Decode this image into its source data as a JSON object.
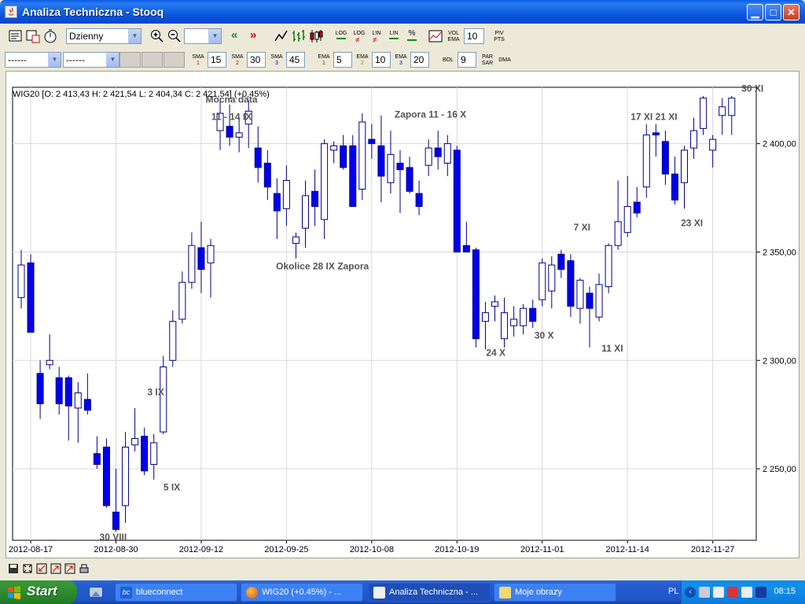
{
  "window": {
    "title": "Analiza Techniczna - Stooq"
  },
  "toolbar1": {
    "interval_select": "Dzienny",
    "zoom_select": "",
    "vol_ema_label_1": "VOL",
    "vol_ema_label_2": "EMA",
    "vol_ema_value": "10",
    "piv_label_1": "PIV",
    "piv_label_2": "PTS",
    "log1": "LOG",
    "log2": "LOG",
    "lin1": "LIN",
    "lin2": "LIN",
    "pct": "%"
  },
  "toolbar2": {
    "select1": "------",
    "select2": "------",
    "sma1_label": "SMA",
    "sma1_num": "1",
    "sma1_value": "15",
    "sma2_label": "SMA",
    "sma2_num": "2",
    "sma2_value": "30",
    "sma3_label": "SMA",
    "sma3_num": "3",
    "sma3_value": "45",
    "ema1_label": "EMA",
    "ema1_num": "1",
    "ema1_value": "5",
    "ema2_label": "EMA",
    "ema2_num": "2",
    "ema2_value": "10",
    "ema3_label": "EMA",
    "ema3_num": "3",
    "ema3_value": "20",
    "bol_label": "BOL",
    "bol_value": "9",
    "par_label_1": "PAR",
    "par_label_2": "SAR",
    "dma_label": "DMA"
  },
  "chart_data": {
    "type": "candlestick",
    "legend_text": "WIG20 [O: 2 413,43  H: 2 421,54  L: 2 404,34  C: 2 421,54] (+0,45%)",
    "ylim": [
      2217,
      2426
    ],
    "y_ticks": [
      2250,
      2300,
      2350,
      2400
    ],
    "y_tick_labels": [
      "2 250,00",
      "2 300,00",
      "2 350,00",
      "2 400,00"
    ],
    "x_tick_labels": [
      "2012-08-17",
      "2012-08-30",
      "2012-09-12",
      "2012-09-25",
      "2012-10-08",
      "2012-10-19",
      "2012-11-01",
      "2012-11-14",
      "2012-11-27"
    ],
    "x_tick_indices": [
      1,
      10,
      19,
      28,
      37,
      46,
      55,
      64,
      73
    ],
    "candles": [
      {
        "o": 2329,
        "h": 2351,
        "l": 2324,
        "c": 2344
      },
      {
        "o": 2345,
        "h": 2349,
        "l": 2318,
        "c": 2313
      },
      {
        "o": 2294,
        "h": 2300,
        "l": 2273,
        "c": 2280
      },
      {
        "o": 2298,
        "h": 2312,
        "l": 2296,
        "c": 2300
      },
      {
        "o": 2292,
        "h": 2297,
        "l": 2275,
        "c": 2280
      },
      {
        "o": 2292,
        "h": 2293,
        "l": 2263,
        "c": 2279
      },
      {
        "o": 2278,
        "h": 2290,
        "l": 2262,
        "c": 2285
      },
      {
        "o": 2282,
        "h": 2294,
        "l": 2275,
        "c": 2277
      },
      {
        "o": 2257,
        "h": 2265,
        "l": 2250,
        "c": 2252
      },
      {
        "o": 2260,
        "h": 2264,
        "l": 2232,
        "c": 2233
      },
      {
        "o": 2230,
        "h": 2250,
        "l": 2221,
        "c": 2222
      },
      {
        "o": 2233,
        "h": 2267,
        "l": 2225,
        "c": 2260
      },
      {
        "o": 2261,
        "h": 2278,
        "l": 2258,
        "c": 2264
      },
      {
        "o": 2265,
        "h": 2269,
        "l": 2247,
        "c": 2249
      },
      {
        "o": 2252,
        "h": 2266,
        "l": 2245,
        "c": 2262
      },
      {
        "o": 2267,
        "h": 2302,
        "l": 2266,
        "c": 2297
      },
      {
        "o": 2300,
        "h": 2323,
        "l": 2297,
        "c": 2318
      },
      {
        "o": 2319,
        "h": 2341,
        "l": 2317,
        "c": 2336
      },
      {
        "o": 2336,
        "h": 2359,
        "l": 2333,
        "c": 2353
      },
      {
        "o": 2352,
        "h": 2364,
        "l": 2331,
        "c": 2342
      },
      {
        "o": 2345,
        "h": 2356,
        "l": 2329,
        "c": 2353
      },
      {
        "o": 2406,
        "h": 2421,
        "l": 2397,
        "c": 2414
      },
      {
        "o": 2408,
        "h": 2418,
        "l": 2399,
        "c": 2403
      },
      {
        "o": 2403,
        "h": 2412,
        "l": 2396,
        "c": 2405
      },
      {
        "o": 2409,
        "h": 2420,
        "l": 2398,
        "c": 2415
      },
      {
        "o": 2398,
        "h": 2408,
        "l": 2382,
        "c": 2389
      },
      {
        "o": 2391,
        "h": 2397,
        "l": 2374,
        "c": 2380
      },
      {
        "o": 2377,
        "h": 2384,
        "l": 2356,
        "c": 2369
      },
      {
        "o": 2370,
        "h": 2390,
        "l": 2362,
        "c": 2383
      },
      {
        "o": 2354,
        "h": 2359,
        "l": 2347,
        "c": 2357
      },
      {
        "o": 2361,
        "h": 2383,
        "l": 2352,
        "c": 2376
      },
      {
        "o": 2378,
        "h": 2388,
        "l": 2362,
        "c": 2371
      },
      {
        "o": 2365,
        "h": 2402,
        "l": 2356,
        "c": 2400
      },
      {
        "o": 2397,
        "h": 2401,
        "l": 2391,
        "c": 2399
      },
      {
        "o": 2399,
        "h": 2404,
        "l": 2388,
        "c": 2389
      },
      {
        "o": 2399,
        "h": 2404,
        "l": 2376,
        "c": 2371
      },
      {
        "o": 2379,
        "h": 2414,
        "l": 2374,
        "c": 2410
      },
      {
        "o": 2402,
        "h": 2409,
        "l": 2393,
        "c": 2400
      },
      {
        "o": 2399,
        "h": 2413,
        "l": 2373,
        "c": 2385
      },
      {
        "o": 2382,
        "h": 2406,
        "l": 2377,
        "c": 2395
      },
      {
        "o": 2391,
        "h": 2397,
        "l": 2368,
        "c": 2388
      },
      {
        "o": 2389,
        "h": 2394,
        "l": 2377,
        "c": 2378
      },
      {
        "o": 2377,
        "h": 2383,
        "l": 2367,
        "c": 2371
      },
      {
        "o": 2390,
        "h": 2402,
        "l": 2385,
        "c": 2398
      },
      {
        "o": 2398,
        "h": 2406,
        "l": 2388,
        "c": 2394
      },
      {
        "o": 2391,
        "h": 2404,
        "l": 2385,
        "c": 2400
      },
      {
        "o": 2397,
        "h": 2399,
        "l": 2350,
        "c": 2350
      },
      {
        "o": 2353,
        "h": 2364,
        "l": 2350,
        "c": 2350
      },
      {
        "o": 2351,
        "h": 2352,
        "l": 2306,
        "c": 2310
      },
      {
        "o": 2318,
        "h": 2327,
        "l": 2305,
        "c": 2322
      },
      {
        "o": 2325,
        "h": 2330,
        "l": 2318,
        "c": 2327
      },
      {
        "o": 2310,
        "h": 2329,
        "l": 2306,
        "c": 2322
      },
      {
        "o": 2316,
        "h": 2325,
        "l": 2311,
        "c": 2319
      },
      {
        "o": 2316,
        "h": 2326,
        "l": 2312,
        "c": 2324
      },
      {
        "o": 2324,
        "h": 2328,
        "l": 2315,
        "c": 2318
      },
      {
        "o": 2328,
        "h": 2347,
        "l": 2325,
        "c": 2345
      },
      {
        "o": 2332,
        "h": 2348,
        "l": 2324,
        "c": 2344
      },
      {
        "o": 2349,
        "h": 2351,
        "l": 2338,
        "c": 2342
      },
      {
        "o": 2346,
        "h": 2349,
        "l": 2320,
        "c": 2325
      },
      {
        "o": 2324,
        "h": 2338,
        "l": 2317,
        "c": 2337
      },
      {
        "o": 2331,
        "h": 2334,
        "l": 2306,
        "c": 2324
      },
      {
        "o": 2320,
        "h": 2340,
        "l": 2318,
        "c": 2335
      },
      {
        "o": 2334,
        "h": 2354,
        "l": 2331,
        "c": 2353
      },
      {
        "o": 2353,
        "h": 2383,
        "l": 2351,
        "c": 2364
      },
      {
        "o": 2359,
        "h": 2385,
        "l": 2357,
        "c": 2371
      },
      {
        "o": 2373,
        "h": 2380,
        "l": 2366,
        "c": 2368
      },
      {
        "o": 2380,
        "h": 2409,
        "l": 2375,
        "c": 2404
      },
      {
        "o": 2405,
        "h": 2409,
        "l": 2394,
        "c": 2404
      },
      {
        "o": 2401,
        "h": 2406,
        "l": 2381,
        "c": 2386
      },
      {
        "o": 2386,
        "h": 2394,
        "l": 2372,
        "c": 2374
      },
      {
        "o": 2382,
        "h": 2399,
        "l": 2370,
        "c": 2397
      },
      {
        "o": 2398,
        "h": 2412,
        "l": 2393,
        "c": 2406
      },
      {
        "o": 2407,
        "h": 2422,
        "l": 2404,
        "c": 2421
      },
      {
        "o": 2397,
        "h": 2404,
        "l": 2389,
        "c": 2402
      },
      {
        "o": 2413,
        "h": 2421,
        "l": 2404,
        "c": 2417
      },
      {
        "o": 2413,
        "h": 2422,
        "l": 2404,
        "c": 2421
      }
    ],
    "annotations": [
      {
        "text": "Mocna data",
        "x": 22.2,
        "y": 2419
      },
      {
        "text": "11 - 14 IX",
        "x": 22.2,
        "y": 2411
      },
      {
        "text": "Zapora 11 - 16 X",
        "x": 43.2,
        "y": 2412
      },
      {
        "text": "17 XI 21 XI",
        "x": 66.8,
        "y": 2411
      },
      {
        "text": "30 XI",
        "x": 77.2,
        "y": 2424
      },
      {
        "text": "7 XI",
        "x": 59.2,
        "y": 2360
      },
      {
        "text": "23 XI",
        "x": 70.8,
        "y": 2362
      },
      {
        "text": "Okolice 28 IX Zapora",
        "x": 31.8,
        "y": 2342
      },
      {
        "text": "3 IX",
        "x": 14.2,
        "y": 2284
      },
      {
        "text": "5 IX",
        "x": 15.9,
        "y": 2240
      },
      {
        "text": "30 VIII",
        "x": 9.7,
        "y": 2217
      },
      {
        "text": "24 X",
        "x": 50.1,
        "y": 2302
      },
      {
        "text": "30 X",
        "x": 55.2,
        "y": 2310
      },
      {
        "text": "11 XI",
        "x": 62.4,
        "y": 2304
      }
    ]
  },
  "bottom_toolbar": {},
  "taskbar": {
    "start_label": "Start",
    "tasks": [
      {
        "label": "blueconnect"
      },
      {
        "label": "WIG20 (+0.45%) - ..."
      },
      {
        "label": "Analiza Techniczna - ..."
      },
      {
        "label": "Moje obrazy"
      }
    ],
    "lang": "PL",
    "clock": "08:15"
  },
  "colors": {
    "candle_down": "#0000ee",
    "candle_up": "#ffffff",
    "candle_outline": "#00008b",
    "grid": "#d8d8d8",
    "annotation": "#555555",
    "titlebar": "#0a58e0",
    "taskbar": "#245ccf"
  }
}
